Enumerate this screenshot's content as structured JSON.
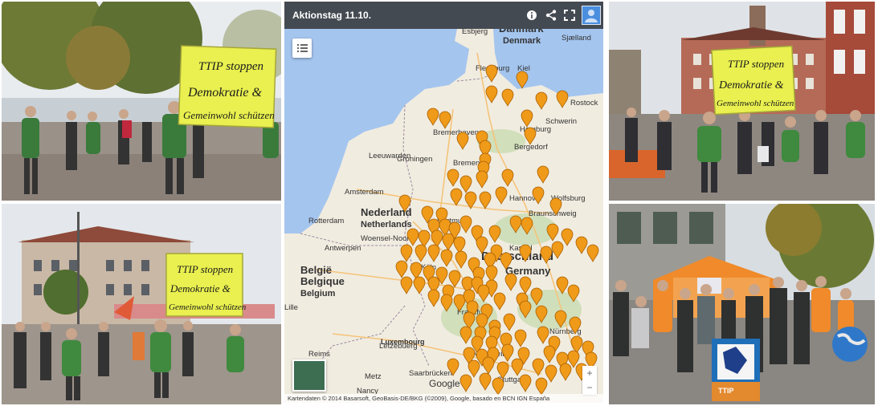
{
  "photos": {
    "top_left_sign": [
      "TTIP stoppen",
      "Demokratie &",
      "Gemeinwohl schützen"
    ],
    "top_right_sign": [
      "TTIP stoppen",
      "Demokratie &",
      "Gemeinwohl schützen"
    ],
    "bottom_left_sign": [
      "TTIP stoppen",
      "Demokratie &",
      "Gemeinwohl schützen"
    ],
    "stand_poster": "TTIP"
  },
  "map": {
    "title": "Aktionstag 11.10.",
    "attribution": "Kartendaten © 2014 Basarsoft, GeoBasis-DE/BKG (©2009), Google, basado en BCN IGN España",
    "zoom_in": "+",
    "zoom_out": "−",
    "countries": [
      {
        "key": "danmark",
        "label": "Danmark"
      },
      {
        "key": "denmark",
        "label": "Denmark"
      },
      {
        "key": "nederland",
        "label": "Nederland"
      },
      {
        "key": "netherlands",
        "label": "Netherlands"
      },
      {
        "key": "belgique",
        "label": "België"
      },
      {
        "key": "belgium",
        "label": "Belgique"
      },
      {
        "key": "belgium2",
        "label": "Belgium"
      },
      {
        "key": "deutschland",
        "label": "Deutschland"
      },
      {
        "key": "germany",
        "label": "Germany"
      },
      {
        "key": "luxembourg",
        "label": "Luxembourg"
      }
    ],
    "cities": [
      {
        "key": "esbjerg",
        "label": "Esbjerg"
      },
      {
        "key": "sjaelland",
        "label": "Sjælland"
      },
      {
        "key": "flensburg",
        "label": "Flensburg"
      },
      {
        "key": "kiel",
        "label": "Kiel"
      },
      {
        "key": "rostock",
        "label": "Rostock"
      },
      {
        "key": "bremerhaven",
        "label": "Bremerhaven"
      },
      {
        "key": "hamburg",
        "label": "Hamburg"
      },
      {
        "key": "schwerin",
        "label": "Schwerin"
      },
      {
        "key": "leeuwarden",
        "label": "Leeuwarden"
      },
      {
        "key": "groningen",
        "label": "Groningen"
      },
      {
        "key": "bremen",
        "label": "Bremen"
      },
      {
        "key": "bergedorf",
        "label": "Bergedorf"
      },
      {
        "key": "amsterdam",
        "label": "Amsterdam"
      },
      {
        "key": "hannover",
        "label": "Hannover"
      },
      {
        "key": "wolfsburg",
        "label": "Wolfsburg"
      },
      {
        "key": "rotterdam",
        "label": "Rotterdam"
      },
      {
        "key": "braunschweig",
        "label": "Braunschweig"
      },
      {
        "key": "woensel",
        "label": "Woensel-Noord"
      },
      {
        "key": "antwerpen",
        "label": "Antwerpen"
      },
      {
        "key": "dortmund",
        "label": "Dortmund"
      },
      {
        "key": "kassel",
        "label": "Kassel"
      },
      {
        "key": "koeln",
        "label": "Köln"
      },
      {
        "key": "lille",
        "label": "Lille"
      },
      {
        "key": "frankfurt",
        "label": "Frankfurt"
      },
      {
        "key": "letzeburg",
        "label": "Lëtzebuerg"
      },
      {
        "key": "mannheim",
        "label": "Mannheim"
      },
      {
        "key": "nuernberg",
        "label": "Nürnberg"
      },
      {
        "key": "saarbruecken",
        "label": "Saarbrücken"
      },
      {
        "key": "reims",
        "label": "Reims"
      },
      {
        "key": "metz",
        "label": "Metz"
      },
      {
        "key": "stuttgart",
        "label": "Stuttgart"
      },
      {
        "key": "nancy",
        "label": "Nancy"
      },
      {
        "key": "google",
        "label": "Google"
      }
    ]
  }
}
